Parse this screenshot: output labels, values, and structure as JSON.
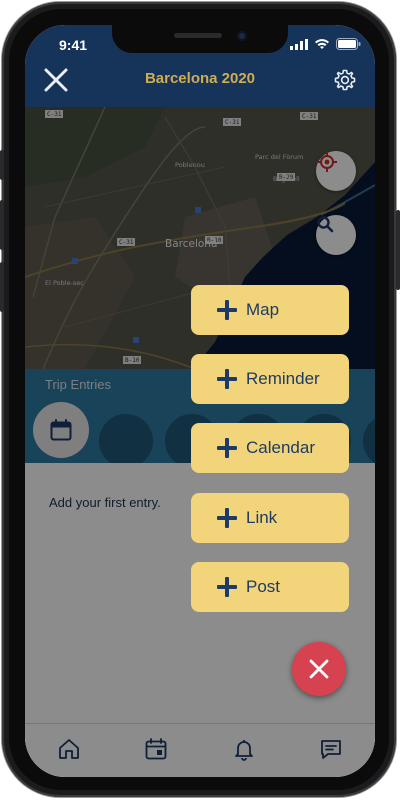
{
  "status_bar": {
    "time": "9:41"
  },
  "header": {
    "title": "Barcelona 2020",
    "close_icon": "close-icon",
    "settings_icon": "gear-icon"
  },
  "map": {
    "city_label": "Barcelona",
    "locate_icon": "crosshair-icon",
    "search_icon": "search-icon",
    "road_labels": [
      "C-31",
      "C-31",
      "B-10",
      "B-20",
      "B-10",
      "C-31",
      "C-31"
    ],
    "place_labels": [
      "El Poble-sec",
      "Poblenou",
      "Parc del Fòrum",
      "Bogatell"
    ]
  },
  "entries": {
    "title": "Trip Entries",
    "calendar_icon": "calendar-icon"
  },
  "empty_state": {
    "text": "Add your first entry."
  },
  "menu_items": [
    "Map",
    "Reminder",
    "Calendar",
    "Link",
    "Post"
  ],
  "close_button_icon": "close-icon",
  "tabbar": {
    "items": [
      "home-icon",
      "calendar-icon",
      "bell-icon",
      "message-icon"
    ]
  },
  "colors": {
    "header": "#16335a",
    "title": "#cfae52",
    "entries_band": "#2d7aa0",
    "menu_button": "#f2d57a",
    "menu_text": "#1e3a66",
    "close_fab": "#d64250"
  }
}
